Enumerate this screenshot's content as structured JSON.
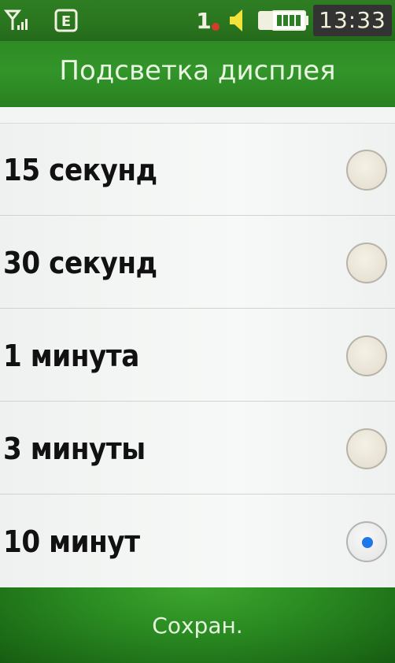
{
  "status_bar": {
    "signal_icon": "signal-icon",
    "network_type": "E",
    "sim_slot": "1",
    "speaker_icon": "speaker-icon",
    "battery_icon": "battery-icon",
    "time": "13:33"
  },
  "header": {
    "title": "Подсветка дисплея"
  },
  "options": [
    {
      "label": "15 секунд",
      "selected": false
    },
    {
      "label": "30 секунд",
      "selected": false
    },
    {
      "label": "1 минута",
      "selected": false
    },
    {
      "label": "3 минуты",
      "selected": false
    },
    {
      "label": "10 минут",
      "selected": true
    }
  ],
  "softkey": {
    "save_label": "Сохран."
  },
  "colors": {
    "accent_green": "#2f8a23",
    "radio_selected_dot": "#1f78e8"
  }
}
